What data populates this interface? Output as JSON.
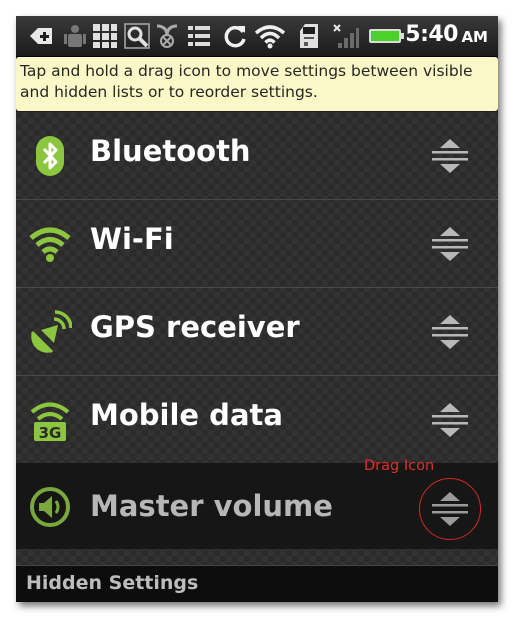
{
  "status_bar": {
    "time": "5:40",
    "ampm": "AM",
    "icons": [
      "add-notification-icon",
      "usb-debug-icon",
      "keyboard-icon",
      "search-icon",
      "sync-blocked-icon",
      "menu-icon",
      "sync-icon",
      "wifi-icon",
      "sd-card-icon",
      "signal-icon",
      "battery-icon"
    ]
  },
  "hint": {
    "text": "Tap and hold a drag icon to move settings between visible and hidden lists or to reorder settings."
  },
  "settings": [
    {
      "label": "Bluetooth",
      "icon": "bluetooth-icon"
    },
    {
      "label": "Wi-Fi",
      "icon": "wifi-icon"
    },
    {
      "label": "GPS receiver",
      "icon": "gps-icon"
    },
    {
      "label": "Mobile data",
      "icon": "mobile-data-3g-icon"
    },
    {
      "label": "Master volume",
      "icon": "volume-icon"
    }
  ],
  "annotation": {
    "label": "Drag Icon"
  },
  "hidden_section": {
    "title": "Hidden Settings"
  },
  "colors": {
    "accent_green": "#8cc63f",
    "hint_bg": "#fbf8c7",
    "annotation_red": "#e0302a"
  }
}
